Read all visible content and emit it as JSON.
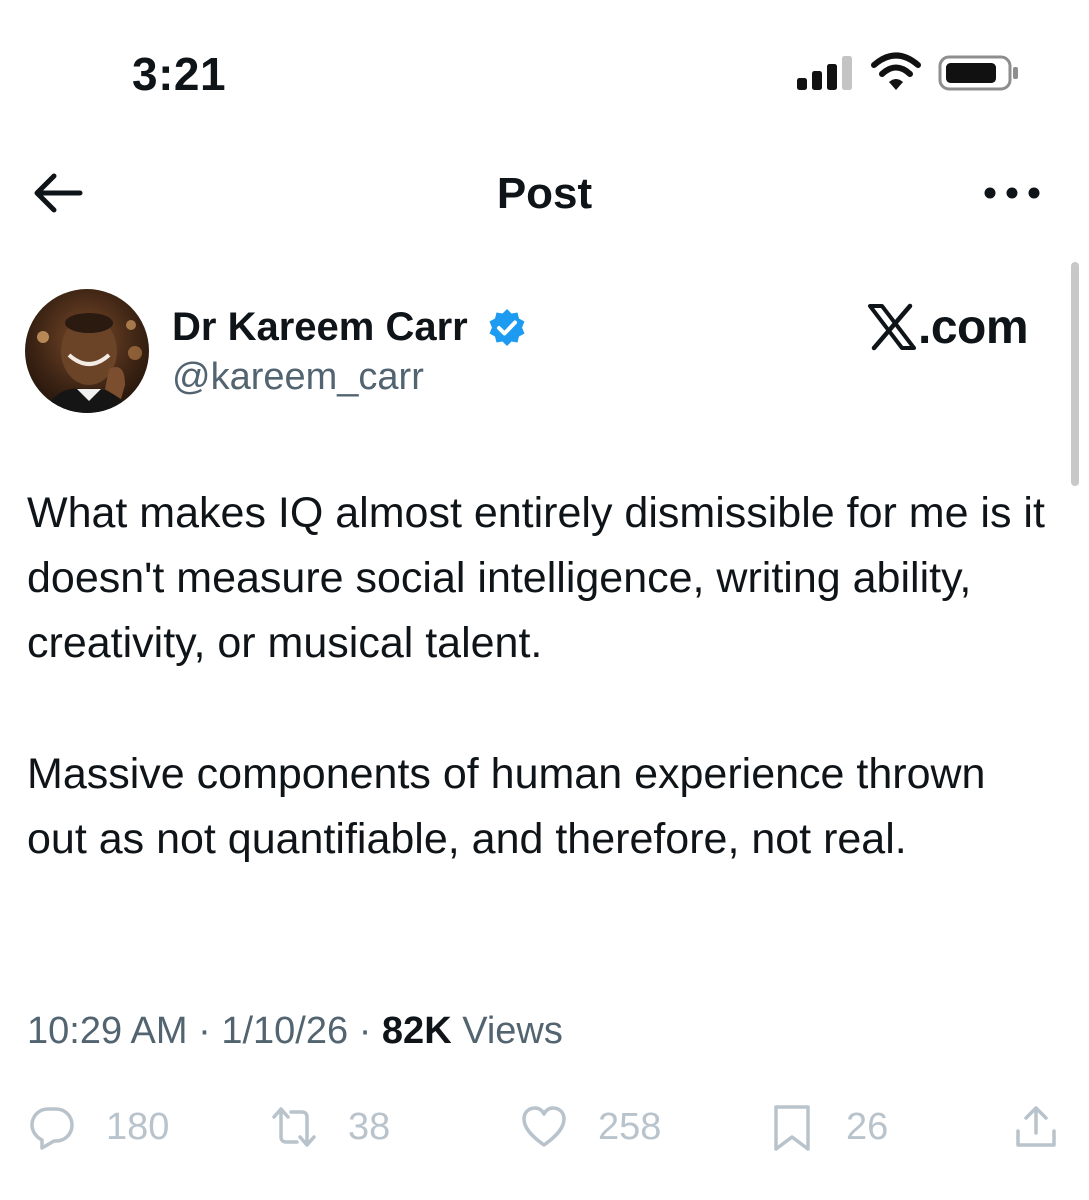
{
  "status_bar": {
    "time": "3:21"
  },
  "nav": {
    "title": "Post",
    "back_icon": "arrow-left-icon",
    "more_icon": "ellipsis-icon"
  },
  "author": {
    "name": "Dr Kareem Carr",
    "handle": "@kareem_carr",
    "verified": true
  },
  "watermark": {
    "text": ".com"
  },
  "tweet": {
    "paragraph_1": "What makes IQ almost entirely dismissible for me is it doesn't measure social intelligence, writing ability, creativity, or musical talent.",
    "paragraph_2": "Massive components of human experience thrown out as not quantifiable, and therefore, not real."
  },
  "meta": {
    "time": "10:29 AM",
    "separator": " · ",
    "date": "1/10/26",
    "views_count": "82K",
    "views_label": " Views"
  },
  "actions": {
    "replies": "180",
    "reposts": "38",
    "likes": "258",
    "bookmarks": "26"
  },
  "colors": {
    "text": "#0f1419",
    "secondary": "#536471",
    "action_gray": "#b9c3cc",
    "verified_blue": "#1d9bf0"
  }
}
